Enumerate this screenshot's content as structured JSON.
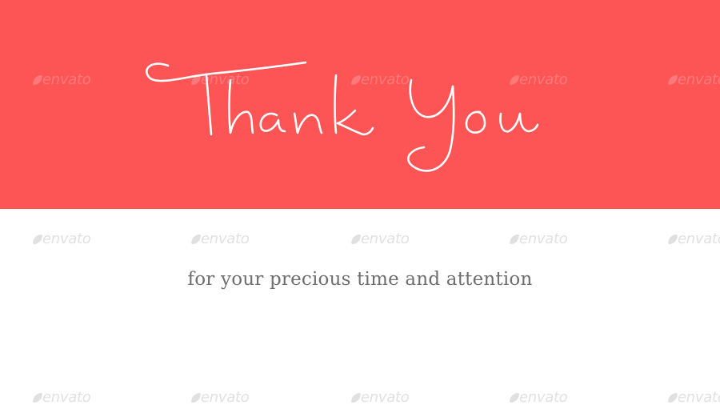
{
  "slide": {
    "headline": "Thank You",
    "subtitle": "for your precious time and attention"
  },
  "watermark": {
    "text": "envato",
    "icon": "envato-leaf-icon"
  },
  "colors": {
    "band": "#fd5455",
    "headline": "#ffffff",
    "subtitle": "#6e6e6e",
    "background": "#ffffff"
  }
}
